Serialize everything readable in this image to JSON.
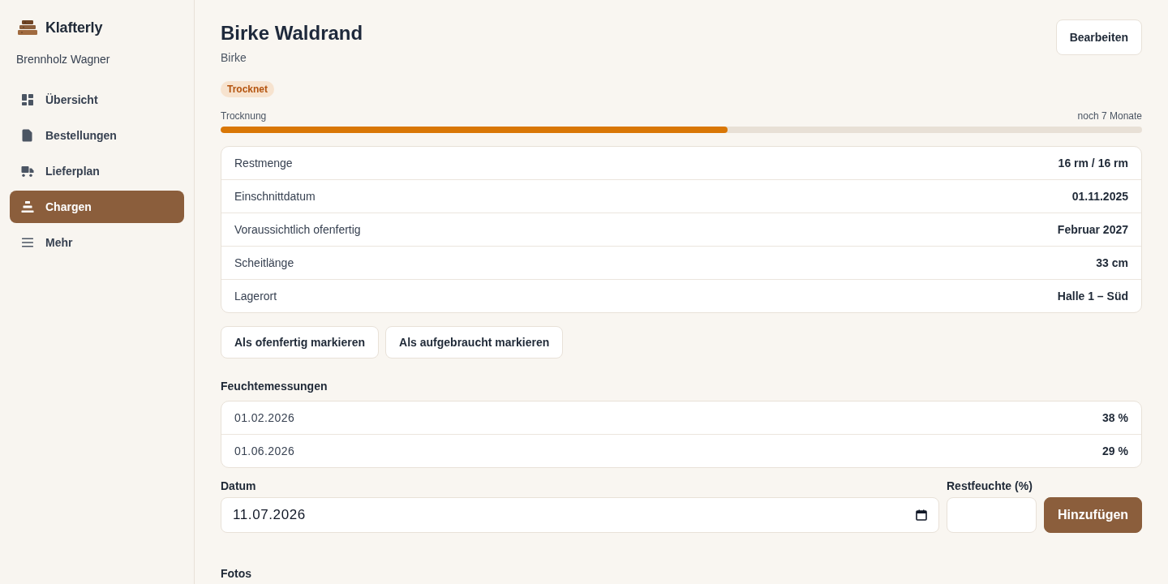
{
  "sidebar": {
    "brand": "Klafterly",
    "account": "Brennholz Wagner",
    "nav": [
      {
        "label": "Übersicht",
        "selected": false
      },
      {
        "label": "Bestellungen",
        "selected": false
      },
      {
        "label": "Lieferplan",
        "selected": false
      },
      {
        "label": "Chargen",
        "selected": true
      },
      {
        "label": "Mehr",
        "selected": false
      }
    ]
  },
  "header": {
    "title": "Birke Waldrand",
    "subtitle": "Birke",
    "action": "Bearbeiten"
  },
  "status_badge": "Trocknet",
  "drying": {
    "label": "Trocknung",
    "remaining": "noch 7 Monate",
    "level": 0.55
  },
  "details": [
    {
      "label": "Restmenge",
      "value": "16 rm / 16 rm"
    },
    {
      "label": "Einschnittdatum",
      "value": "01.11.2025"
    },
    {
      "label": "Voraussichtlich ofenfertig",
      "value": "Februar 2027"
    },
    {
      "label": "Scheitlänge",
      "value": "33 cm"
    },
    {
      "label": "Lagerort",
      "value": "Halle 1 – Süd"
    }
  ],
  "actions": [
    "Als ofenfertig markieren",
    "Als aufgebraucht markieren"
  ],
  "moisture": {
    "title": "Feuchtemessungen",
    "rows": [
      {
        "date": "01.02.2026",
        "value": "38 %"
      },
      {
        "date": "01.06.2026",
        "value": "29 %"
      }
    ]
  },
  "form": {
    "date_label": "Datum",
    "date_value": "11.07.2026",
    "moisture_label": "Restfeuchte (%)",
    "submit": "Hinzufügen"
  },
  "photos": {
    "title": "Fotos"
  }
}
